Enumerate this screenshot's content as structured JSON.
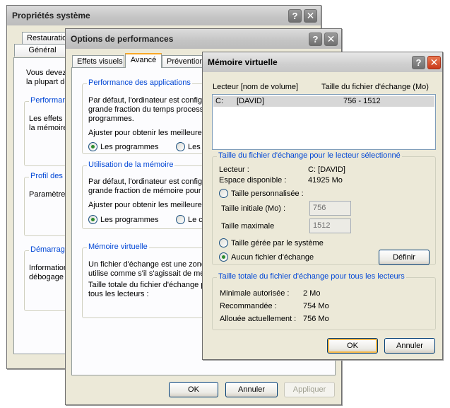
{
  "system_props": {
    "title": "Propriétés système",
    "tabs": [
      "Restauration",
      "Général"
    ],
    "intro": [
      "Vous devez",
      "la plupart de"
    ],
    "groups": [
      {
        "legend": "Performance",
        "lines": [
          "Les effets",
          "la mémoire"
        ]
      },
      {
        "legend": "Profil des u",
        "lines": [
          "Paramètre"
        ]
      },
      {
        "legend": "Démarrage",
        "lines": [
          "Information",
          "débogage"
        ]
      }
    ]
  },
  "perf_options": {
    "title": "Options de performances",
    "tabs": [
      "Effets visuels",
      "Avancé",
      "Prévention"
    ],
    "app_perf": {
      "legend": "Performance des applications",
      "desc": [
        "Par défaut, l'ordinateur est config",
        "grande fraction du temps process",
        "programmes."
      ],
      "adjust": "Ajuster pour obtenir les meilleures",
      "radio_programs": "Les programmes",
      "radio_other": "Les s"
    },
    "mem_usage": {
      "legend": "Utilisation de la mémoire",
      "desc": [
        "Par défaut, l'ordinateur est config",
        "grande fraction de mémoire pour"
      ],
      "adjust": "Ajuster pour obtenir les meilleures",
      "radio_programs": "Les programmes",
      "radio_other": "Le ca"
    },
    "virtual_mem": {
      "legend": "Mémoire virtuelle",
      "desc": [
        "Un fichier d'échange est une zone",
        "utilise comme s'il s'agissait de mé",
        "Taille totale du fichier d'échange p",
        "tous les lecteurs :"
      ]
    },
    "buttons": {
      "ok": "OK",
      "cancel": "Annuler",
      "apply": "Appliquer"
    }
  },
  "virt_mem": {
    "title": "Mémoire virtuelle",
    "col_drive": "Lecteur [nom de volume]",
    "col_size": "Taille du fichier d'échange (Mo)",
    "drives": [
      {
        "drive": "C:",
        "volume": "[DAVID]",
        "size": "756 - 1512"
      }
    ],
    "selected": {
      "legend": "Taille du fichier d'échange pour le lecteur sélectionné",
      "drive_label": "Lecteur :",
      "drive_value": "C:  [DAVID]",
      "space_label": "Espace disponible :",
      "space_value": "41925 Mo",
      "custom_label": "Taille personnalisée :",
      "initial_label": "Taille initiale (Mo) :",
      "initial_value": "756",
      "max_label": "Taille maximale",
      "max_value": "1512",
      "system_label": "Taille gérée par le système",
      "none_label": "Aucun fichier d'échange",
      "set_button": "Définir"
    },
    "total": {
      "legend": "Taille totale du fichier d'échange pour tous les lecteurs",
      "min_label": "Minimale autorisée :",
      "min_value": "2 Mo",
      "rec_label": "Recommandée :",
      "rec_value": "754 Mo",
      "alloc_label": "Allouée actuellement :",
      "alloc_value": "756 Mo"
    },
    "buttons": {
      "ok": "OK",
      "cancel": "Annuler"
    }
  },
  "titlebar_buttons": {
    "help": "?",
    "close": "✕"
  }
}
